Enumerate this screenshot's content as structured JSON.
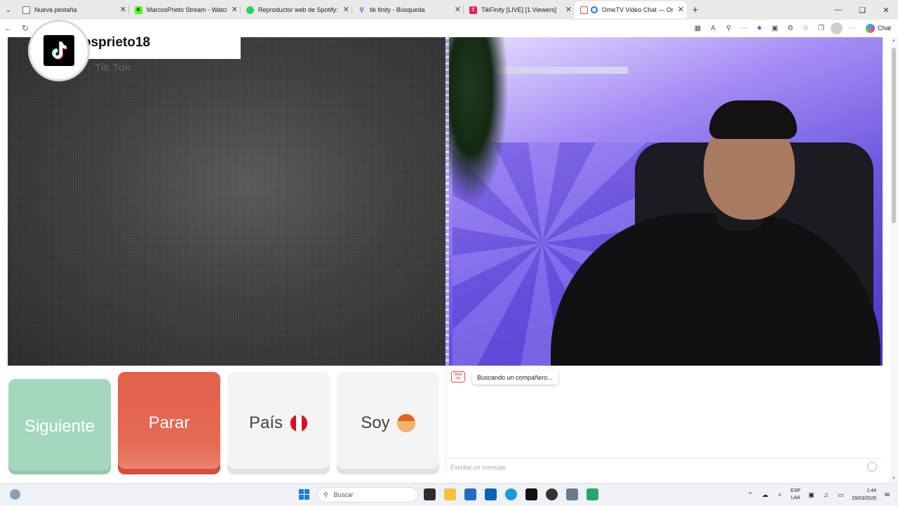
{
  "browser": {
    "tabs": [
      {
        "title": "Nueva pestaña",
        "favicon_color": "#5f6b7a",
        "active": false
      },
      {
        "title": "MarcosPrieto Stream - Watch Live",
        "favicon_color": "#53fc18",
        "active": false
      },
      {
        "title": "Reproductor web de Spotify: músi",
        "favicon_color": "#1ed760",
        "active": false
      },
      {
        "title": "tik finity - Búsqueda",
        "favicon_color": "#2a73d8",
        "active": false
      },
      {
        "title": "TikFinity [LIVE] [1 Viewers]",
        "favicon_color": "#e0245e",
        "active": false
      },
      {
        "title": "OmeTV Video Chat — Omegl",
        "favicon_color": "#e84a3c",
        "active": true
      }
    ],
    "chat_button_label": "Chat"
  },
  "overlay": {
    "username": "osprieto18",
    "subtitle": "Tik Tok"
  },
  "controls": {
    "next_label": "Siguiente",
    "stop_label": "Parar",
    "country_label": "País",
    "gender_label": "Soy"
  },
  "chat": {
    "logo_text": "Ome TV",
    "status": "Buscando un compañero...",
    "input_placeholder": "Escribe un mensaje"
  },
  "taskbar": {
    "search_placeholder": "Buscar",
    "lang_top": "ESP",
    "lang_bottom": "LAA",
    "time": "1:44",
    "date": "29/03/2026"
  },
  "colors": {
    "accent_next": "#a3d8bf",
    "accent_stop": "#e2614b",
    "browser_accent": "#1d7ce0"
  }
}
